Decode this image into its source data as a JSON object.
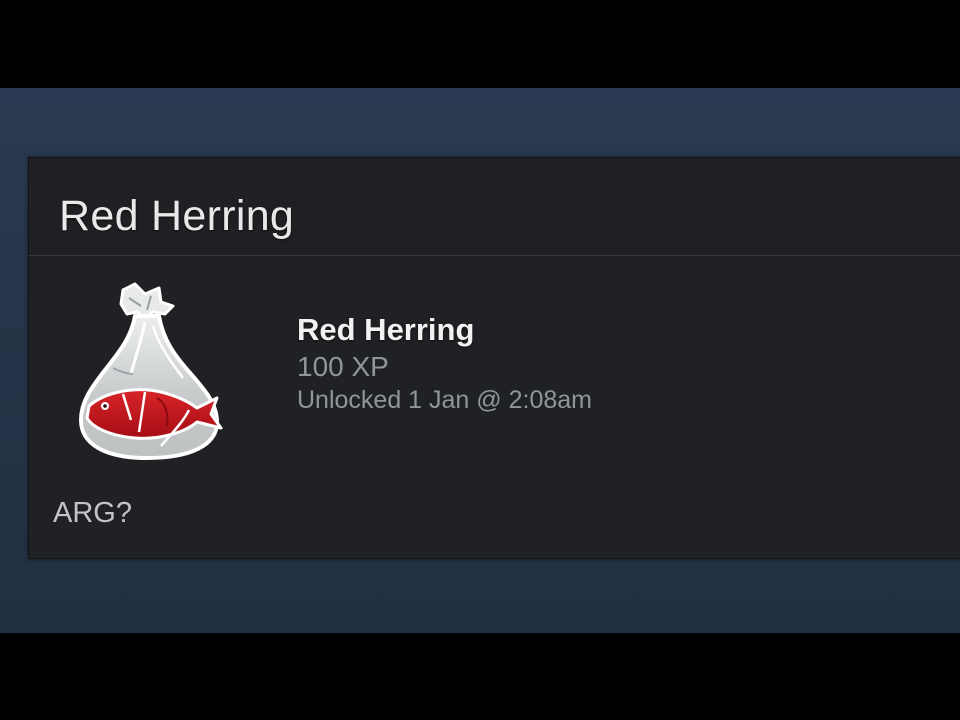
{
  "panel": {
    "title": "Red Herring"
  },
  "achievement": {
    "name": "Red Herring",
    "xp": "100 XP",
    "unlocked": "Unlocked 1 Jan @ 2:08am",
    "description": "ARG?",
    "icon": "red-herring-in-bag-icon"
  },
  "colors": {
    "background": "#000000",
    "blue_band": "#263549",
    "panel": "#202124",
    "title_text": "#e9e9e9",
    "muted_text": "#8f959a",
    "fish_red": "#c0141a"
  }
}
